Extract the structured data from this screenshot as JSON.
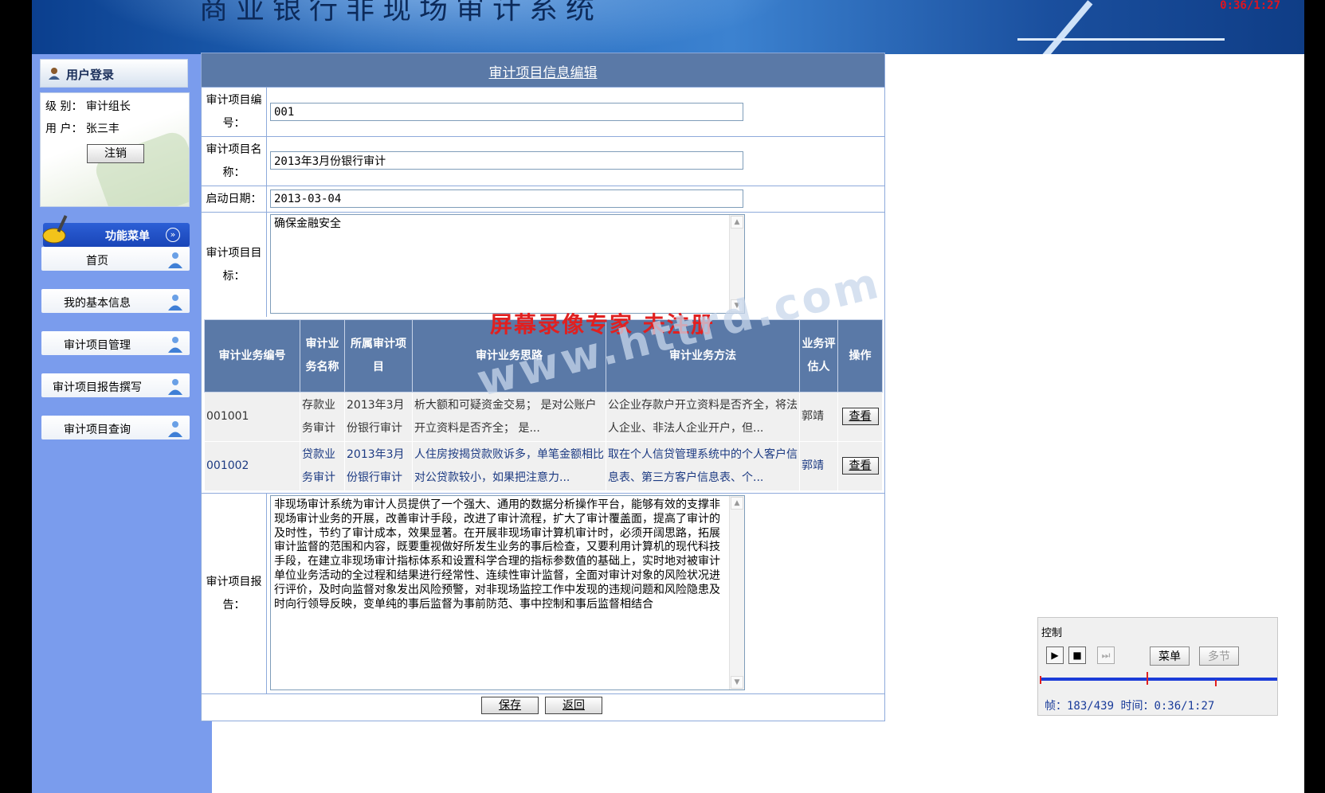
{
  "header": {
    "site_title": "商业银行非现场审计系统",
    "recording_time": "0:36/1:27"
  },
  "sidebar": {
    "login_title": "用户登录",
    "level_label": "级 别：",
    "level_value": "审计组长",
    "user_label": "用 户：",
    "user_value": "张三丰",
    "logout_label": "注销",
    "menu_title": "功能菜单",
    "items": [
      {
        "label": "首页"
      },
      {
        "label": "我的基本信息"
      },
      {
        "label": "审计项目管理"
      },
      {
        "label": "审计项目报告撰写"
      },
      {
        "label": "审计项目查询"
      }
    ]
  },
  "form": {
    "title": "审计项目信息编辑",
    "project_no_label": "审计项目编号：",
    "project_no_value": "001",
    "project_name_label": "审计项目名称：",
    "project_name_value": "2013年3月份银行审计",
    "start_date_label": "启动日期：",
    "start_date_value": "2013-03-04",
    "goal_label": "审计项目目标：",
    "goal_value": "确保金融安全",
    "report_label": "审计项目报告：",
    "report_value": "非现场审计系统为审计人员提供了一个强大、通用的数据分析操作平台，能够有效的支撑非现场审计业务的开展，改善审计手段，改进了审计流程，扩大了审计覆盖面，提高了审计的及时性，节约了审计成本，效果显著。在开展非现场审计算机审计时，必须开阔思路，拓展审计监督的范围和内容，既要重视做好所发生业务的事后检查，又要利用计算机的现代科技手段，在建立非现场审计指标体系和设置科学合理的指标参数值的基础上，实时地对被审计单位业务活动的全过程和结果进行经常性、连续性审计监督，全面对审计对象的风险状况进行评价，及时向监督对象发出风险预警，对非现场监控工作中发现的违规问题和风险隐患及时向行领导反映，变单纯的事后监督为事前防范、事中控制和事后监督相结合",
    "save_label": "保存",
    "back_label": "返回"
  },
  "business_table": {
    "headers": [
      "审计业务编号",
      "审计业务名称",
      "所属审计项目",
      "审计业务思路",
      "审计业务方法",
      "业务评估人",
      "操作"
    ],
    "rows": [
      {
        "no": "001001",
        "name": "存款业务审计",
        "project": "2013年3月份银行审计",
        "idea": "析大额和可疑资金交易； 是对公账户开立资料是否齐全； 是...",
        "method": "公企业存款户开立资料是否齐全，将法人企业、非法人企业开户，但...",
        "assessor": "郭靖",
        "action": "查看"
      },
      {
        "no": "001002",
        "name": "贷款业务审计",
        "project": "2013年3月份银行审计",
        "idea": "人住房按揭贷款败诉多，单笔金额相比对公贷款较小，如果把注意力...",
        "method": "取在个人信贷管理系统中的个人客户信息表、第三方客户信息表、个...",
        "assessor": "郭靖",
        "action": "查看"
      }
    ]
  },
  "watermark": {
    "line1": "屏幕录像专家  未注册",
    "line2": "www.httrd.com"
  },
  "control_panel": {
    "title": "控制",
    "menu_label": "菜单",
    "multi_label": "多节",
    "frame_label": "帧：",
    "frame_value": "183/439",
    "time_label": "时间：",
    "time_value": "0:36/1:27"
  },
  "colors": {
    "banner": "#2165b8",
    "sidebar": "#7a9ced",
    "table_header": "#5a79a7",
    "watermark_red": "#e02020"
  }
}
